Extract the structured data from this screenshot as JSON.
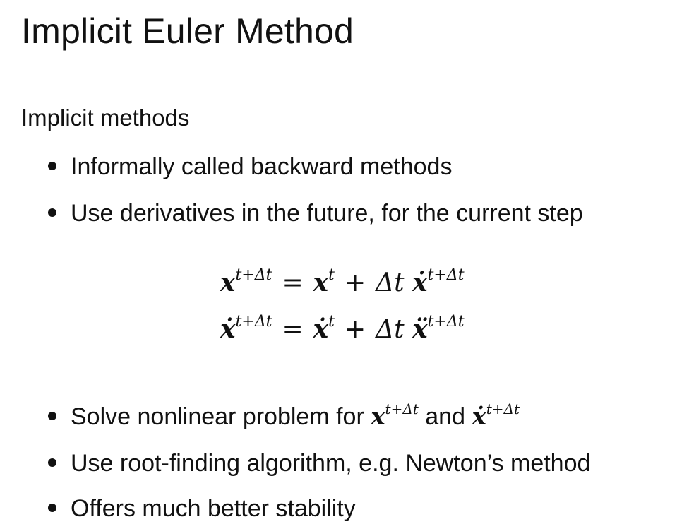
{
  "title": "Implicit Euler Method",
  "subheading": "Implicit methods",
  "bullets_top": [
    "Informally called backward methods",
    "Use derivatives in the future, for the current step"
  ],
  "equations": {
    "eq1": {
      "lhs_var": "x",
      "lhs_sup": "t+Δt",
      "equals": "=",
      "rhs_var": "x",
      "rhs_sup": "t",
      "plus": "+",
      "delta_t": "Δt",
      "deriv_var": "ẋ",
      "deriv_sup": "t+Δt"
    },
    "eq2": {
      "lhs_var": "ẋ",
      "lhs_sup": "t+Δt",
      "equals": "=",
      "rhs_var": "ẋ",
      "rhs_sup": "t",
      "plus": "+",
      "delta_t": "Δt",
      "deriv_var": "ẍ",
      "deriv_sup": "t+Δt"
    }
  },
  "bullet_solve": {
    "text_before": "Solve nonlinear problem for",
    "var1": "x",
    "var1_sup": "t+Δt",
    "text_mid": "and",
    "var2": "ẋ",
    "var2_sup": "t+Δt"
  },
  "bullets_bottom": [
    "Use root-finding algorithm, e.g. Newton’s method",
    "Offers much better stability"
  ]
}
